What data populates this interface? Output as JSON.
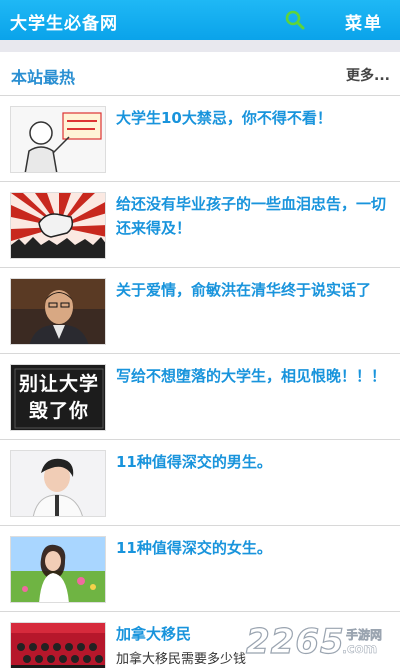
{
  "header": {
    "title": "大学生必备网",
    "menu_label": "菜单"
  },
  "section": {
    "title": "本站最热",
    "more": "更多..."
  },
  "items": [
    {
      "title": "大学生10大禁忌，你不得不看！",
      "thumb_text": ""
    },
    {
      "title": "给还没有毕业孩子的一些血泪忠告，一切还来得及！",
      "thumb_text": ""
    },
    {
      "title": "关于爱情，俞敏洪在清华终于说实话了",
      "thumb_text": ""
    },
    {
      "title": "写给不想堕落的大学生，相见恨晚！！！",
      "thumb_text": "别让大学毁了你"
    },
    {
      "title": "11种值得深交的男生。",
      "thumb_text": ""
    },
    {
      "title": "11种值得深交的女生。",
      "thumb_text": ""
    },
    {
      "title": "加拿大移民",
      "subtitle": "加拿大移民需要多少钱",
      "thumb_text": ""
    }
  ],
  "watermark": {
    "brand": "2265",
    "suffix": ".com",
    "tag": "手游网"
  }
}
